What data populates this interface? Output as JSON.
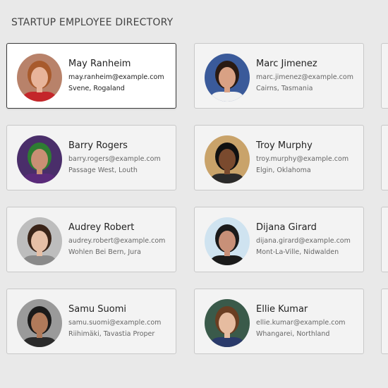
{
  "header": {
    "title": "STARTUP EMPLOYEE DIRECTORY"
  },
  "employees": [
    {
      "name": "May Ranheim",
      "email": "may.ranheim@example.com",
      "location": "Svene, Rogaland",
      "selected": true,
      "avatar": {
        "bg": "#b8826a",
        "hair": "#a85a2c",
        "skin": "#e8b49a",
        "shirt": "#c4262a"
      }
    },
    {
      "name": "Marc Jimenez",
      "email": "marc.jimenez@example.com",
      "location": "Cairns, Tasmania",
      "avatar": {
        "bg": "#3a5a9a",
        "hair": "#2a1a12",
        "skin": "#d9a184",
        "shirt": "#f0f0f0"
      }
    },
    {
      "name": "Barry Rogers",
      "email": "barry.rogers@example.com",
      "location": "Passage West, Louth",
      "avatar": {
        "bg": "#4a2e6a",
        "hair": "#2e7d32",
        "skin": "#c98f74",
        "shirt": "#5a2a7a"
      }
    },
    {
      "name": "Troy Murphy",
      "email": "troy.murphy@example.com",
      "location": "Elgin, Oklahoma",
      "avatar": {
        "bg": "#c9a36a",
        "hair": "#111111",
        "skin": "#7a4a2e",
        "shirt": "#2a2a2a"
      }
    },
    {
      "name": "Audrey Robert",
      "email": "audrey.robert@example.com",
      "location": "Wohlen Bei Bern, Jura",
      "avatar": {
        "bg": "#bdbdbd",
        "hair": "#3a2418",
        "skin": "#e6bfa6",
        "shirt": "#8a8a8a"
      }
    },
    {
      "name": "Dijana Girard",
      "email": "dijana.girard@example.com",
      "location": "Mont-La-Ville, Nidwalden",
      "avatar": {
        "bg": "#cfe3f0",
        "hair": "#1a1a1a",
        "skin": "#c89078",
        "shirt": "#1a1a1a"
      }
    },
    {
      "name": "Samu Suomi",
      "email": "samu.suomi@example.com",
      "location": "Riihimäki, Tavastia Proper",
      "avatar": {
        "bg": "#9a9a9a",
        "hair": "#1a1a1a",
        "skin": "#b07a5a",
        "shirt": "#2a2a2a"
      }
    },
    {
      "name": "Ellie Kumar",
      "email": "ellie.kumar@example.com",
      "location": "Whangarei, Northland",
      "avatar": {
        "bg": "#3a5a4a",
        "hair": "#6a3e22",
        "skin": "#e6bca0",
        "shirt": "#2a3a6a"
      }
    }
  ]
}
